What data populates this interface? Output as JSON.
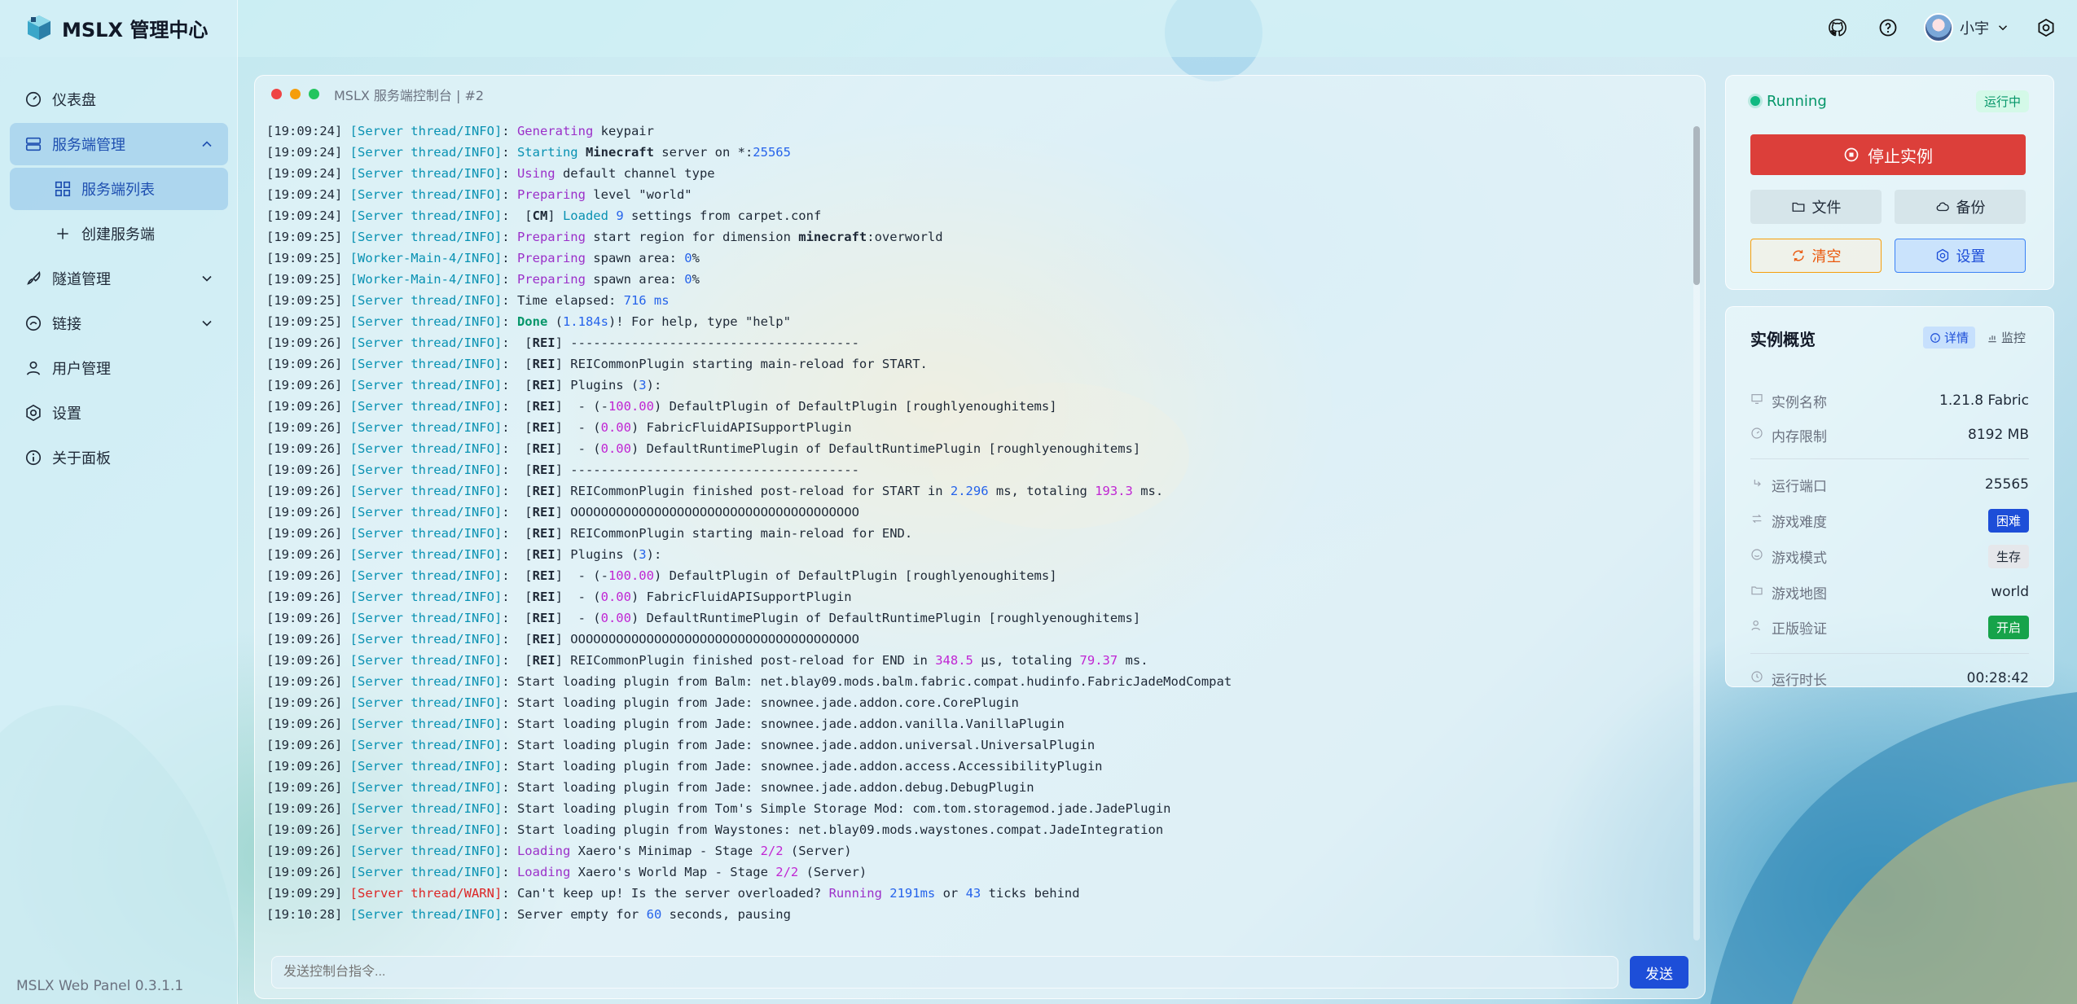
{
  "app": {
    "title": "MSLX 管理中心",
    "version": "MSLX Web Panel 0.3.1.1"
  },
  "sidebar": {
    "items": [
      {
        "label": "仪表盘",
        "icon": "dashboard-icon"
      },
      {
        "label": "服务端管理",
        "icon": "server-icon",
        "expanded": true
      },
      {
        "label": "服务端列表",
        "icon": "grid-icon"
      },
      {
        "label": "创建服务端",
        "icon": "plus-icon"
      },
      {
        "label": "隧道管理",
        "icon": "rocket-icon"
      },
      {
        "label": "链接",
        "icon": "link-icon"
      },
      {
        "label": "用户管理",
        "icon": "user-icon"
      },
      {
        "label": "设置",
        "icon": "gear-icon"
      },
      {
        "label": "关于面板",
        "icon": "info-icon"
      }
    ]
  },
  "topbar": {
    "user_name": "小宇"
  },
  "console": {
    "title": "MSLX 服务端控制台 | #2",
    "input_placeholder": "发送控制台指令...",
    "send_label": "发送",
    "lines": [
      [
        [
          "ts",
          "[19:09:24] "
        ],
        [
          "th",
          "[Server thread/INFO]"
        ],
        [
          "ts",
          ": "
        ],
        [
          "pu",
          "Generating"
        ],
        [
          "ts",
          " keypair"
        ]
      ],
      [
        [
          "ts",
          "[19:09:24] "
        ],
        [
          "th",
          "[Server thread/INFO]"
        ],
        [
          "ts",
          ": "
        ],
        [
          "gr2",
          "Starting"
        ],
        [
          "ts",
          " "
        ],
        [
          "bd",
          "Minecraft"
        ],
        [
          "ts",
          " server on *:"
        ],
        [
          "nu",
          "25565"
        ]
      ],
      [
        [
          "ts",
          "[19:09:24] "
        ],
        [
          "th",
          "[Server thread/INFO]"
        ],
        [
          "ts",
          ": "
        ],
        [
          "pu",
          "Using"
        ],
        [
          "ts",
          " default channel type"
        ]
      ],
      [
        [
          "ts",
          "[19:09:24] "
        ],
        [
          "th",
          "[Server thread/INFO]"
        ],
        [
          "ts",
          ": "
        ],
        [
          "pu",
          "Preparing"
        ],
        [
          "ts",
          " level \"world\""
        ]
      ],
      [
        [
          "ts",
          "[19:09:24] "
        ],
        [
          "th",
          "[Server thread/INFO]"
        ],
        [
          "ts",
          ":  ["
        ],
        [
          "bd",
          "CM"
        ],
        [
          "ts",
          "] "
        ],
        [
          "gr2",
          "Loaded"
        ],
        [
          "ts",
          " "
        ],
        [
          "nu",
          "9"
        ],
        [
          "ts",
          " settings from carpet.conf"
        ]
      ],
      [
        [
          "ts",
          "[19:09:25] "
        ],
        [
          "th",
          "[Server thread/INFO]"
        ],
        [
          "ts",
          ": "
        ],
        [
          "pu",
          "Preparing"
        ],
        [
          "ts",
          " start region for dimension "
        ],
        [
          "bd",
          "minecraft"
        ],
        [
          "ts",
          ":overworld"
        ]
      ],
      [
        [
          "ts",
          "[19:09:25] "
        ],
        [
          "th",
          "[Worker-Main-4/INFO]"
        ],
        [
          "ts",
          ": "
        ],
        [
          "pu",
          "Preparing"
        ],
        [
          "ts",
          " spawn area: "
        ],
        [
          "nu",
          "0"
        ],
        [
          "ts",
          "%"
        ]
      ],
      [
        [
          "ts",
          "[19:09:25] "
        ],
        [
          "th",
          "[Worker-Main-4/INFO]"
        ],
        [
          "ts",
          ": "
        ],
        [
          "pu",
          "Preparing"
        ],
        [
          "ts",
          " spawn area: "
        ],
        [
          "nu",
          "0"
        ],
        [
          "ts",
          "%"
        ]
      ],
      [
        [
          "ts",
          "[19:09:25] "
        ],
        [
          "th",
          "[Server thread/INFO]"
        ],
        [
          "ts",
          ": Time elapsed: "
        ],
        [
          "nu",
          "716 ms"
        ]
      ],
      [
        [
          "ts",
          "[19:09:25] "
        ],
        [
          "th",
          "[Server thread/INFO]"
        ],
        [
          "ts",
          ": "
        ],
        [
          "gr",
          "Done"
        ],
        [
          "ts",
          " ("
        ],
        [
          "nu",
          "1.184s"
        ],
        [
          "ts",
          ")! For help, type \"help\""
        ]
      ],
      [
        [
          "ts",
          "[19:09:26] "
        ],
        [
          "th",
          "[Server thread/INFO]"
        ],
        [
          "ts",
          ":  ["
        ],
        [
          "bd",
          "REI"
        ],
        [
          "ts",
          "] --------------------------------------"
        ]
      ],
      [
        [
          "ts",
          "[19:09:26] "
        ],
        [
          "th",
          "[Server thread/INFO]"
        ],
        [
          "ts",
          ":  ["
        ],
        [
          "bd",
          "REI"
        ],
        [
          "ts",
          "] REICommonPlugin starting main-reload for START."
        ]
      ],
      [
        [
          "ts",
          "[19:09:26] "
        ],
        [
          "th",
          "[Server thread/INFO]"
        ],
        [
          "ts",
          ":  ["
        ],
        [
          "bd",
          "REI"
        ],
        [
          "ts",
          "] Plugins ("
        ],
        [
          "nu",
          "3"
        ],
        [
          "ts",
          "):"
        ]
      ],
      [
        [
          "ts",
          "[19:09:26] "
        ],
        [
          "th",
          "[Server thread/INFO]"
        ],
        [
          "ts",
          ":  ["
        ],
        [
          "bd",
          "REI"
        ],
        [
          "ts",
          "]  - (-"
        ],
        [
          "ww",
          "100.00"
        ],
        [
          "ts",
          ") DefaultPlugin of DefaultPlugin [roughlyenoughitems]"
        ]
      ],
      [
        [
          "ts",
          "[19:09:26] "
        ],
        [
          "th",
          "[Server thread/INFO]"
        ],
        [
          "ts",
          ":  ["
        ],
        [
          "bd",
          "REI"
        ],
        [
          "ts",
          "]  - ("
        ],
        [
          "ww",
          "0.00"
        ],
        [
          "ts",
          ") FabricFluidAPISupportPlugin"
        ]
      ],
      [
        [
          "ts",
          "[19:09:26] "
        ],
        [
          "th",
          "[Server thread/INFO]"
        ],
        [
          "ts",
          ":  ["
        ],
        [
          "bd",
          "REI"
        ],
        [
          "ts",
          "]  - ("
        ],
        [
          "ww",
          "0.00"
        ],
        [
          "ts",
          ") DefaultRuntimePlugin of DefaultRuntimePlugin [roughlyenoughitems]"
        ]
      ],
      [
        [
          "ts",
          "[19:09:26] "
        ],
        [
          "th",
          "[Server thread/INFO]"
        ],
        [
          "ts",
          ":  ["
        ],
        [
          "bd",
          "REI"
        ],
        [
          "ts",
          "] --------------------------------------"
        ]
      ],
      [
        [
          "ts",
          "[19:09:26] "
        ],
        [
          "th",
          "[Server thread/INFO]"
        ],
        [
          "ts",
          ":  ["
        ],
        [
          "bd",
          "REI"
        ],
        [
          "ts",
          "] REICommonPlugin finished post-reload for START in "
        ],
        [
          "nu",
          "2.296"
        ],
        [
          "ts",
          " ms, totaling "
        ],
        [
          "ww",
          "193.3"
        ],
        [
          "ts",
          " ms."
        ]
      ],
      [
        [
          "ts",
          "[19:09:26] "
        ],
        [
          "th",
          "[Server thread/INFO]"
        ],
        [
          "ts",
          ":  ["
        ],
        [
          "bd",
          "REI"
        ],
        [
          "ts",
          "] OOOOOOOOOOOOOOOOOOOOOOOOOOOOOOOOOOOOOO"
        ]
      ],
      [
        [
          "ts",
          "[19:09:26] "
        ],
        [
          "th",
          "[Server thread/INFO]"
        ],
        [
          "ts",
          ":  ["
        ],
        [
          "bd",
          "REI"
        ],
        [
          "ts",
          "] REICommonPlugin starting main-reload for END."
        ]
      ],
      [
        [
          "ts",
          "[19:09:26] "
        ],
        [
          "th",
          "[Server thread/INFO]"
        ],
        [
          "ts",
          ":  ["
        ],
        [
          "bd",
          "REI"
        ],
        [
          "ts",
          "] Plugins ("
        ],
        [
          "nu",
          "3"
        ],
        [
          "ts",
          "):"
        ]
      ],
      [
        [
          "ts",
          "[19:09:26] "
        ],
        [
          "th",
          "[Server thread/INFO]"
        ],
        [
          "ts",
          ":  ["
        ],
        [
          "bd",
          "REI"
        ],
        [
          "ts",
          "]  - (-"
        ],
        [
          "ww",
          "100.00"
        ],
        [
          "ts",
          ") DefaultPlugin of DefaultPlugin [roughlyenoughitems]"
        ]
      ],
      [
        [
          "ts",
          "[19:09:26] "
        ],
        [
          "th",
          "[Server thread/INFO]"
        ],
        [
          "ts",
          ":  ["
        ],
        [
          "bd",
          "REI"
        ],
        [
          "ts",
          "]  - ("
        ],
        [
          "ww",
          "0.00"
        ],
        [
          "ts",
          ") FabricFluidAPISupportPlugin"
        ]
      ],
      [
        [
          "ts",
          "[19:09:26] "
        ],
        [
          "th",
          "[Server thread/INFO]"
        ],
        [
          "ts",
          ":  ["
        ],
        [
          "bd",
          "REI"
        ],
        [
          "ts",
          "]  - ("
        ],
        [
          "ww",
          "0.00"
        ],
        [
          "ts",
          ") DefaultRuntimePlugin of DefaultRuntimePlugin [roughlyenoughitems]"
        ]
      ],
      [
        [
          "ts",
          "[19:09:26] "
        ],
        [
          "th",
          "[Server thread/INFO]"
        ],
        [
          "ts",
          ":  ["
        ],
        [
          "bd",
          "REI"
        ],
        [
          "ts",
          "] OOOOOOOOOOOOOOOOOOOOOOOOOOOOOOOOOOOOOO"
        ]
      ],
      [
        [
          "ts",
          "[19:09:26] "
        ],
        [
          "th",
          "[Server thread/INFO]"
        ],
        [
          "ts",
          ":  ["
        ],
        [
          "bd",
          "REI"
        ],
        [
          "ts",
          "] REICommonPlugin finished post-reload for END in "
        ],
        [
          "ww",
          "348.5"
        ],
        [
          "ts",
          " µs, totaling "
        ],
        [
          "ww",
          "79.37"
        ],
        [
          "ts",
          " ms."
        ]
      ],
      [
        [
          "ts",
          "[19:09:26] "
        ],
        [
          "th",
          "[Server thread/INFO]"
        ],
        [
          "ts",
          ": Start loading plugin from Balm: net.blay09.mods.balm.fabric.compat.hudinfo.FabricJadeModCompat"
        ]
      ],
      [
        [
          "ts",
          "[19:09:26] "
        ],
        [
          "th",
          "[Server thread/INFO]"
        ],
        [
          "ts",
          ": Start loading plugin from Jade: snownee.jade.addon.core.CorePlugin"
        ]
      ],
      [
        [
          "ts",
          "[19:09:26] "
        ],
        [
          "th",
          "[Server thread/INFO]"
        ],
        [
          "ts",
          ": Start loading plugin from Jade: snownee.jade.addon.vanilla.VanillaPlugin"
        ]
      ],
      [
        [
          "ts",
          "[19:09:26] "
        ],
        [
          "th",
          "[Server thread/INFO]"
        ],
        [
          "ts",
          ": Start loading plugin from Jade: snownee.jade.addon.universal.UniversalPlugin"
        ]
      ],
      [
        [
          "ts",
          "[19:09:26] "
        ],
        [
          "th",
          "[Server thread/INFO]"
        ],
        [
          "ts",
          ": Start loading plugin from Jade: snownee.jade.addon.access.AccessibilityPlugin"
        ]
      ],
      [
        [
          "ts",
          "[19:09:26] "
        ],
        [
          "th",
          "[Server thread/INFO]"
        ],
        [
          "ts",
          ": Start loading plugin from Jade: snownee.jade.addon.debug.DebugPlugin"
        ]
      ],
      [
        [
          "ts",
          "[19:09:26] "
        ],
        [
          "th",
          "[Server thread/INFO]"
        ],
        [
          "ts",
          ": Start loading plugin from Tom's Simple Storage Mod: com.tom.storagemod.jade.JadePlugin"
        ]
      ],
      [
        [
          "ts",
          "[19:09:26] "
        ],
        [
          "th",
          "[Server thread/INFO]"
        ],
        [
          "ts",
          ": Start loading plugin from Waystones: net.blay09.mods.waystones.compat.JadeIntegration"
        ]
      ],
      [
        [
          "ts",
          "[19:09:26] "
        ],
        [
          "th",
          "[Server thread/INFO]"
        ],
        [
          "ts",
          ": "
        ],
        [
          "pu",
          "Loading"
        ],
        [
          "ts",
          " Xaero's Minimap - Stage "
        ],
        [
          "ww",
          "2/2"
        ],
        [
          "ts",
          " (Server)"
        ]
      ],
      [
        [
          "ts",
          "[19:09:26] "
        ],
        [
          "th",
          "[Server thread/INFO]"
        ],
        [
          "ts",
          ": "
        ],
        [
          "pu",
          "Loading"
        ],
        [
          "ts",
          " Xaero's World Map - Stage "
        ],
        [
          "ww",
          "2/2"
        ],
        [
          "ts",
          " (Server)"
        ]
      ],
      [
        [
          "ts",
          "[19:09:29] "
        ],
        [
          "thw",
          "[Server thread/WARN]"
        ],
        [
          "ts",
          ": Can't keep up! Is the server overloaded? "
        ],
        [
          "pu",
          "Running"
        ],
        [
          "ts",
          " "
        ],
        [
          "nu",
          "2191ms"
        ],
        [
          "ts",
          " or "
        ],
        [
          "nu",
          "43"
        ],
        [
          "ts",
          " ticks behind"
        ]
      ],
      [
        [
          "ts",
          "[19:10:28] "
        ],
        [
          "th",
          "[Server thread/INFO]"
        ],
        [
          "ts",
          ": Server empty for "
        ],
        [
          "nu",
          "60"
        ],
        [
          "ts",
          " seconds, pausing"
        ]
      ]
    ]
  },
  "status": {
    "state": "Running",
    "badge": "运行中",
    "stop_label": "停止实例",
    "files_label": "文件",
    "backup_label": "备份",
    "clear_label": "清空",
    "settings_label": "设置"
  },
  "overview": {
    "title": "实例概览",
    "tab_detail": "详情",
    "tab_monitor": "监控",
    "rows": [
      {
        "key": "实例名称",
        "value": "1.21.8 Fabric",
        "icon": "monitor-icon"
      },
      {
        "key": "内存限制",
        "value": "8192 MB",
        "icon": "gauge-icon"
      },
      {
        "key": "运行端口",
        "value": "25565",
        "icon": "port-icon"
      },
      {
        "key": "游戏难度",
        "value": "困难",
        "icon": "swap-icon",
        "tag": "blue"
      },
      {
        "key": "游戏模式",
        "value": "生存",
        "icon": "smile-icon",
        "tag": "gray"
      },
      {
        "key": "游戏地图",
        "value": "world",
        "icon": "folder-icon"
      },
      {
        "key": "正版验证",
        "value": "开启",
        "icon": "user-check-icon",
        "tag": "green"
      },
      {
        "key": "运行时长",
        "value": "00:28:42",
        "icon": "clock-icon"
      }
    ]
  },
  "colors": {
    "accent": "#1d4ed8",
    "danger": "#dc3f3a",
    "success": "#059669",
    "warning": "#ea580c"
  }
}
